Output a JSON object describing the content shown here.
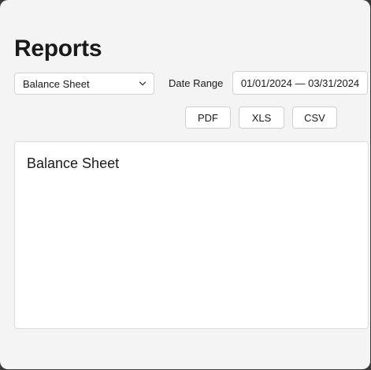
{
  "page": {
    "title": "Reports"
  },
  "filters": {
    "report_type": {
      "selected": "Balance Sheet"
    },
    "date_range": {
      "label": "Date Range",
      "value": "01/01/2024 — 03/31/2024"
    }
  },
  "export": {
    "pdf_label": "PDF",
    "xls_label": "XLS",
    "csv_label": "CSV"
  },
  "report": {
    "title": "Balance Sheet"
  },
  "icons": {
    "select_caret": "chevron-down-icon"
  },
  "colors": {
    "background": "#f4f4f4",
    "surface": "#ffffff",
    "border": "#d3d3d3",
    "text": "#1a1a1a"
  }
}
